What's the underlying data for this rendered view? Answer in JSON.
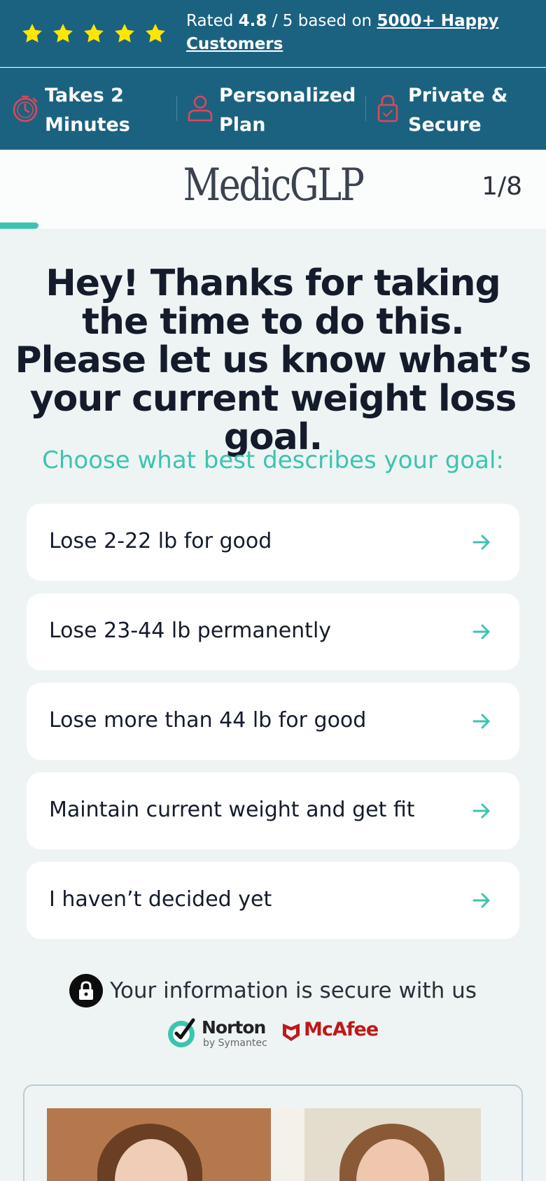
{
  "rating_bar": {
    "star_count": 5,
    "star_color": "#ffe600",
    "prefix": "Rated",
    "score": "4.8",
    "scale": "/ 5 based on",
    "link_text": "5000+ Happy Customers"
  },
  "features": [
    {
      "icon": "stopwatch-icon",
      "line1": "Takes 2",
      "line2": "Minutes"
    },
    {
      "icon": "person-icon",
      "line1": "Personalized",
      "line2": "Plan"
    },
    {
      "icon": "padlock-icon",
      "line1": "Private &",
      "line2": "Secure"
    }
  ],
  "header": {
    "logo": "MedicGLP",
    "step_indicator": "1/8",
    "progress_fraction": 0.07
  },
  "question": {
    "headline": "Hey! Thanks for taking the time to do this. Please let us know what’s your current weight loss goal.",
    "subheading": "Choose what best describes your goal:"
  },
  "options": [
    {
      "label": "Lose 2-22 lb for good"
    },
    {
      "label": "Lose 23-44 lb permanently"
    },
    {
      "label": "Lose more than 44 lb for good"
    },
    {
      "label": "Maintain current weight and get fit"
    },
    {
      "label": "I haven’t decided yet"
    }
  ],
  "security": {
    "text": "Your information is secure with us",
    "norton_name": "Norton",
    "norton_sub": "by Symantec",
    "mcafee_name": "McAfee"
  },
  "colors": {
    "brand_dark": "#1b6280",
    "accent": "#3cc4b1",
    "icon_red": "#e0475a",
    "background": "#eef4f4"
  }
}
